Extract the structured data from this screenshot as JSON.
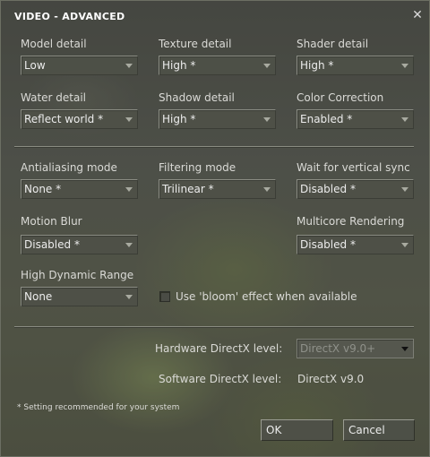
{
  "dialog": {
    "title": "VIDEO - ADVANCED",
    "close_glyph": "✕"
  },
  "settings": {
    "model_detail": {
      "label": "Model detail",
      "value": "Low"
    },
    "texture_detail": {
      "label": "Texture detail",
      "value": "High *"
    },
    "shader_detail": {
      "label": "Shader detail",
      "value": "High *"
    },
    "water_detail": {
      "label": "Water detail",
      "value": "Reflect world *"
    },
    "shadow_detail": {
      "label": "Shadow detail",
      "value": "High *"
    },
    "color_correction": {
      "label": "Color Correction",
      "value": "Enabled *"
    },
    "antialiasing": {
      "label": "Antialiasing mode",
      "value": "None *"
    },
    "filtering": {
      "label": "Filtering mode",
      "value": "Trilinear *"
    },
    "vsync": {
      "label": "Wait for vertical sync",
      "value": "Disabled *"
    },
    "motion_blur": {
      "label": "Motion Blur",
      "value": "Disabled *"
    },
    "multicore": {
      "label": "Multicore Rendering",
      "value": "Disabled *"
    },
    "hdr": {
      "label": "High Dynamic Range",
      "value": "None"
    },
    "bloom": {
      "label": "Use 'bloom' effect when available",
      "checked": false
    }
  },
  "directx": {
    "hardware_label": "Hardware DirectX level:",
    "hardware_value": "DirectX v9.0+",
    "software_label": "Software DirectX level:",
    "software_value": "DirectX v9.0"
  },
  "footnote": "* Setting recommended for your system",
  "buttons": {
    "ok": "OK",
    "cancel": "Cancel"
  },
  "colors": {
    "background": "#565850",
    "text": "#e6e6e6",
    "disabled_text": "#8f918a"
  }
}
